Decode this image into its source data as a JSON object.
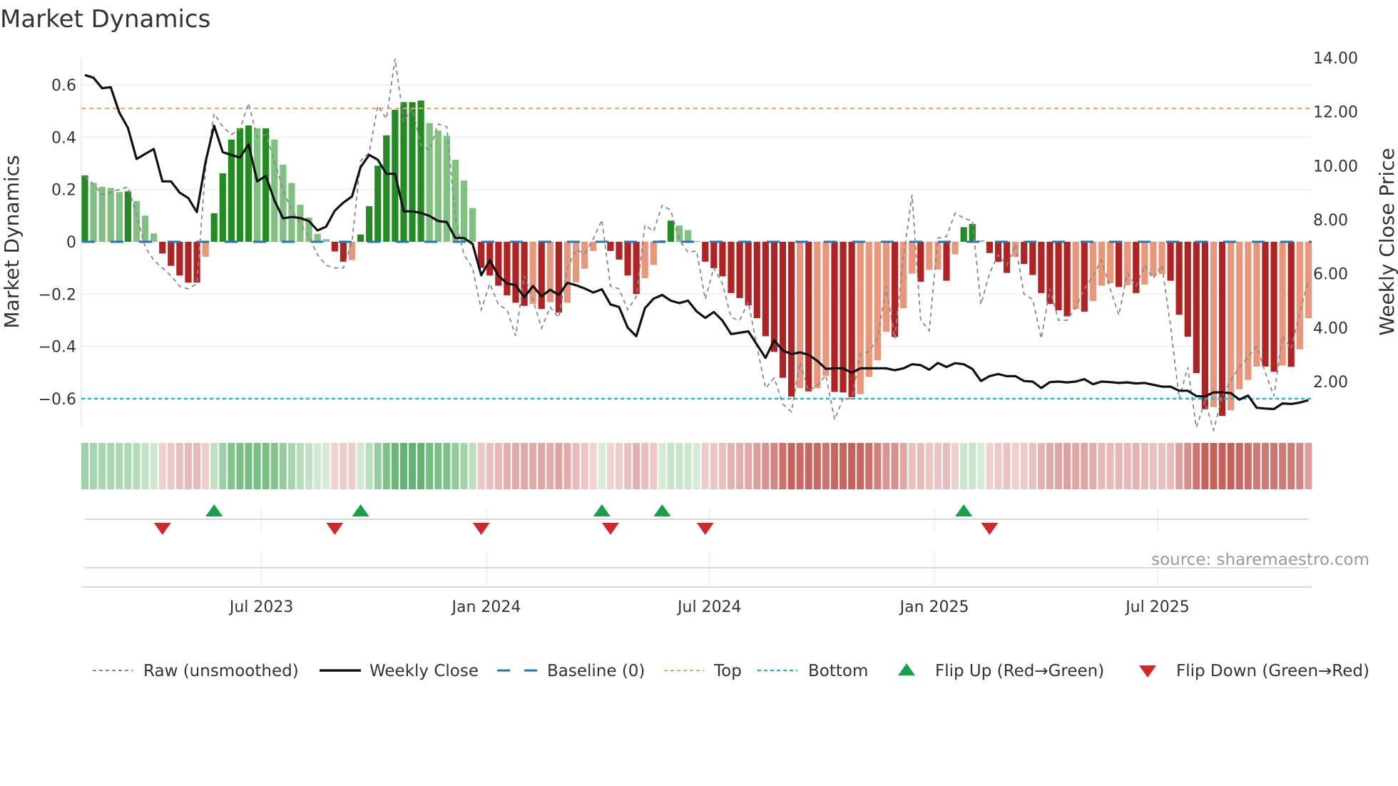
{
  "chart_data": {
    "type": "bar",
    "title": "Market Dynamics",
    "ylabel": "Market Dynamics",
    "y2label": "Weekly Close Price",
    "ylim": [
      -0.72,
      0.72
    ],
    "y2lim": [
      0,
      14
    ],
    "y_ticks": [
      "0.6",
      "0.4",
      "0.2",
      "0",
      "−0.2",
      "−0.4",
      "−0.6"
    ],
    "y_tick_values": [
      0.6,
      0.4,
      0.2,
      0,
      -0.2,
      -0.4,
      -0.6
    ],
    "y2_ticks": [
      "14.00",
      "12.00",
      "10.00",
      "8.00",
      "6.00",
      "4.00",
      "2.00"
    ],
    "y2_tick_values": [
      14,
      12,
      10,
      8,
      6,
      4,
      2
    ],
    "x_ticks": [
      "Jul 2023",
      "Jan 2024",
      "Jul 2024",
      "Jan 2025",
      "Jul 2025"
    ],
    "x_tick_week_index": [
      20.5,
      46.6,
      72.5,
      98.6,
      124.5
    ],
    "frequency": "weekly",
    "top_level": 0.51,
    "bottom_level": -0.6,
    "baseline": 0,
    "grid": true,
    "legend_placement": "bottom",
    "source": "source: sharemaestro.com",
    "legend": [
      {
        "label": "Raw (unsmoothed)",
        "kind": "raw"
      },
      {
        "label": "Weekly Close",
        "kind": "close"
      },
      {
        "label": "Baseline (0)",
        "kind": "baseline"
      },
      {
        "label": "Top",
        "kind": "top"
      },
      {
        "label": "Bottom",
        "kind": "bottom"
      },
      {
        "label": "Flip Up (Red→Green)",
        "kind": "up"
      },
      {
        "label": "Flip Down (Green→Red)",
        "kind": "down"
      }
    ],
    "colors": {
      "pos_strong": "#228b22",
      "pos_weak": "#80c080",
      "neg_strong": "#b22222",
      "neg_weak": "#e9967a",
      "raw": "#888888",
      "close": "#111111",
      "baseline": "#1f77b4",
      "top": "#f4a460",
      "bottom": "#17becf",
      "flip_up": "#18a04a",
      "flip_down": "#d62728"
    },
    "smoothed": [
      0.254,
      0.225,
      0.21,
      0.206,
      0.19,
      0.193,
      0.156,
      0.1,
      0.032,
      -0.045,
      -0.092,
      -0.129,
      -0.156,
      -0.156,
      -0.057,
      0.109,
      0.262,
      0.391,
      0.434,
      0.445,
      0.434,
      0.434,
      0.391,
      0.295,
      0.225,
      0.142,
      0.093,
      0.03,
      0.01,
      -0.037,
      -0.076,
      -0.07,
      0.028,
      0.136,
      0.291,
      0.407,
      0.505,
      0.534,
      0.534,
      0.54,
      0.454,
      0.425,
      0.405,
      0.314,
      0.234,
      0.129,
      -0.1,
      -0.129,
      -0.168,
      -0.205,
      -0.233,
      -0.245,
      -0.238,
      -0.257,
      -0.231,
      -0.271,
      -0.233,
      -0.155,
      -0.103,
      -0.035,
      0.004,
      -0.035,
      -0.068,
      -0.129,
      -0.2,
      -0.139,
      -0.089,
      0.005,
      0.081,
      0.062,
      0.045,
      0.003,
      -0.076,
      -0.101,
      -0.132,
      -0.196,
      -0.215,
      -0.243,
      -0.292,
      -0.361,
      -0.421,
      -0.52,
      -0.592,
      -0.56,
      -0.572,
      -0.56,
      -0.513,
      -0.574,
      -0.576,
      -0.594,
      -0.582,
      -0.517,
      -0.453,
      -0.344,
      -0.364,
      -0.254,
      -0.122,
      -0.153,
      -0.107,
      -0.106,
      -0.149,
      -0.048,
      0.056,
      0.068,
      0.005,
      -0.043,
      -0.077,
      -0.119,
      -0.058,
      -0.085,
      -0.127,
      -0.196,
      -0.238,
      -0.262,
      -0.285,
      -0.257,
      -0.267,
      -0.226,
      -0.168,
      -0.158,
      -0.173,
      -0.166,
      -0.196,
      -0.163,
      -0.131,
      -0.124,
      -0.149,
      -0.279,
      -0.363,
      -0.502,
      -0.64,
      -0.632,
      -0.666,
      -0.644,
      -0.564,
      -0.528,
      -0.477,
      -0.477,
      -0.497,
      -0.473,
      -0.478,
      -0.411,
      -0.292
    ],
    "raw": [
      0.25,
      0.22,
      0.18,
      0.19,
      0.2,
      0.21,
      0.1,
      -0.02,
      -0.07,
      -0.1,
      -0.13,
      -0.17,
      -0.18,
      -0.16,
      0.28,
      0.49,
      0.44,
      0.41,
      0.43,
      0.53,
      0.4,
      0.41,
      0.31,
      0.2,
      0.12,
      0.07,
      0.02,
      -0.05,
      -0.09,
      -0.1,
      -0.1,
      0.0,
      0.31,
      0.34,
      0.52,
      0.47,
      0.7,
      0.46,
      0.51,
      0.37,
      0.35,
      0.45,
      0.44,
      0.09,
      -0.05,
      -0.1,
      -0.26,
      -0.16,
      -0.24,
      -0.26,
      -0.36,
      -0.13,
      -0.22,
      -0.33,
      -0.25,
      -0.29,
      -0.1,
      -0.03,
      -0.045,
      0.01,
      0.084,
      -0.17,
      -0.18,
      -0.26,
      -0.21,
      0.064,
      0.04,
      0.14,
      0.12,
      0.005,
      -0.04,
      -0.035,
      -0.22,
      -0.1,
      -0.16,
      -0.29,
      -0.3,
      -0.23,
      -0.4,
      -0.56,
      -0.52,
      -0.62,
      -0.65,
      -0.46,
      -0.57,
      -0.55,
      -0.51,
      -0.68,
      -0.6,
      -0.6,
      -0.43,
      -0.42,
      -0.37,
      -0.17,
      -0.37,
      -0.06,
      0.18,
      -0.3,
      -0.34,
      0.015,
      0.02,
      0.11,
      0.09,
      0.08,
      -0.24,
      -0.12,
      -0.05,
      -0.09,
      -0.01,
      -0.2,
      -0.22,
      -0.37,
      -0.18,
      -0.3,
      -0.3,
      -0.25,
      -0.18,
      -0.13,
      -0.07,
      -0.18,
      -0.28,
      -0.12,
      -0.17,
      -0.09,
      -0.14,
      -0.09,
      -0.32,
      -0.6,
      -0.48,
      -0.71,
      -0.61,
      -0.72,
      -0.59,
      -0.53,
      -0.48,
      -0.44,
      -0.4,
      -0.5,
      -0.59,
      -0.36,
      -0.41,
      -0.27,
      -0.15
    ],
    "weekly_close": [
      13.36,
      13.26,
      12.87,
      12.91,
      11.97,
      11.4,
      10.25,
      10.44,
      10.62,
      9.42,
      9.42,
      9.0,
      8.8,
      8.28,
      10.13,
      11.48,
      10.5,
      10.4,
      10.3,
      10.79,
      9.42,
      9.62,
      8.71,
      8.05,
      8.1,
      8.06,
      7.95,
      7.6,
      7.74,
      8.33,
      8.63,
      8.86,
      9.95,
      10.4,
      10.22,
      9.7,
      9.7,
      8.31,
      8.31,
      8.25,
      8.14,
      7.95,
      7.91,
      7.32,
      7.32,
      7.1,
      5.94,
      6.49,
      5.92,
      5.64,
      5.57,
      5.12,
      5.54,
      5.16,
      5.4,
      5.21,
      5.66,
      5.57,
      5.45,
      5.3,
      5.42,
      4.86,
      4.76,
      4.0,
      3.68,
      4.72,
      5.07,
      5.21,
      5.0,
      4.91,
      5.0,
      4.6,
      4.36,
      4.58,
      4.26,
      3.76,
      3.81,
      3.86,
      3.37,
      2.88,
      3.53,
      3.15,
      3.02,
      3.08,
      2.99,
      2.77,
      2.47,
      2.49,
      2.49,
      2.33,
      2.49,
      2.49,
      2.49,
      2.49,
      2.42,
      2.49,
      2.64,
      2.61,
      2.44,
      2.69,
      2.54,
      2.68,
      2.64,
      2.47,
      2.02,
      2.2,
      2.28,
      2.2,
      2.2,
      2.02,
      2.0,
      1.76,
      1.98,
      2.0,
      1.97,
      2.0,
      2.09,
      1.9,
      2.0,
      1.98,
      1.95,
      1.97,
      1.93,
      1.95,
      1.88,
      1.81,
      1.81,
      1.66,
      1.66,
      1.46,
      1.45,
      1.6,
      1.6,
      1.57,
      1.33,
      1.48,
      1.03,
      1.0,
      0.98,
      1.19,
      1.17,
      1.22,
      1.31
    ],
    "flip_up_week_index": [
      15,
      32,
      60,
      67,
      102
    ],
    "flip_down_week_index": [
      9,
      29,
      46,
      61,
      72,
      105
    ]
  }
}
